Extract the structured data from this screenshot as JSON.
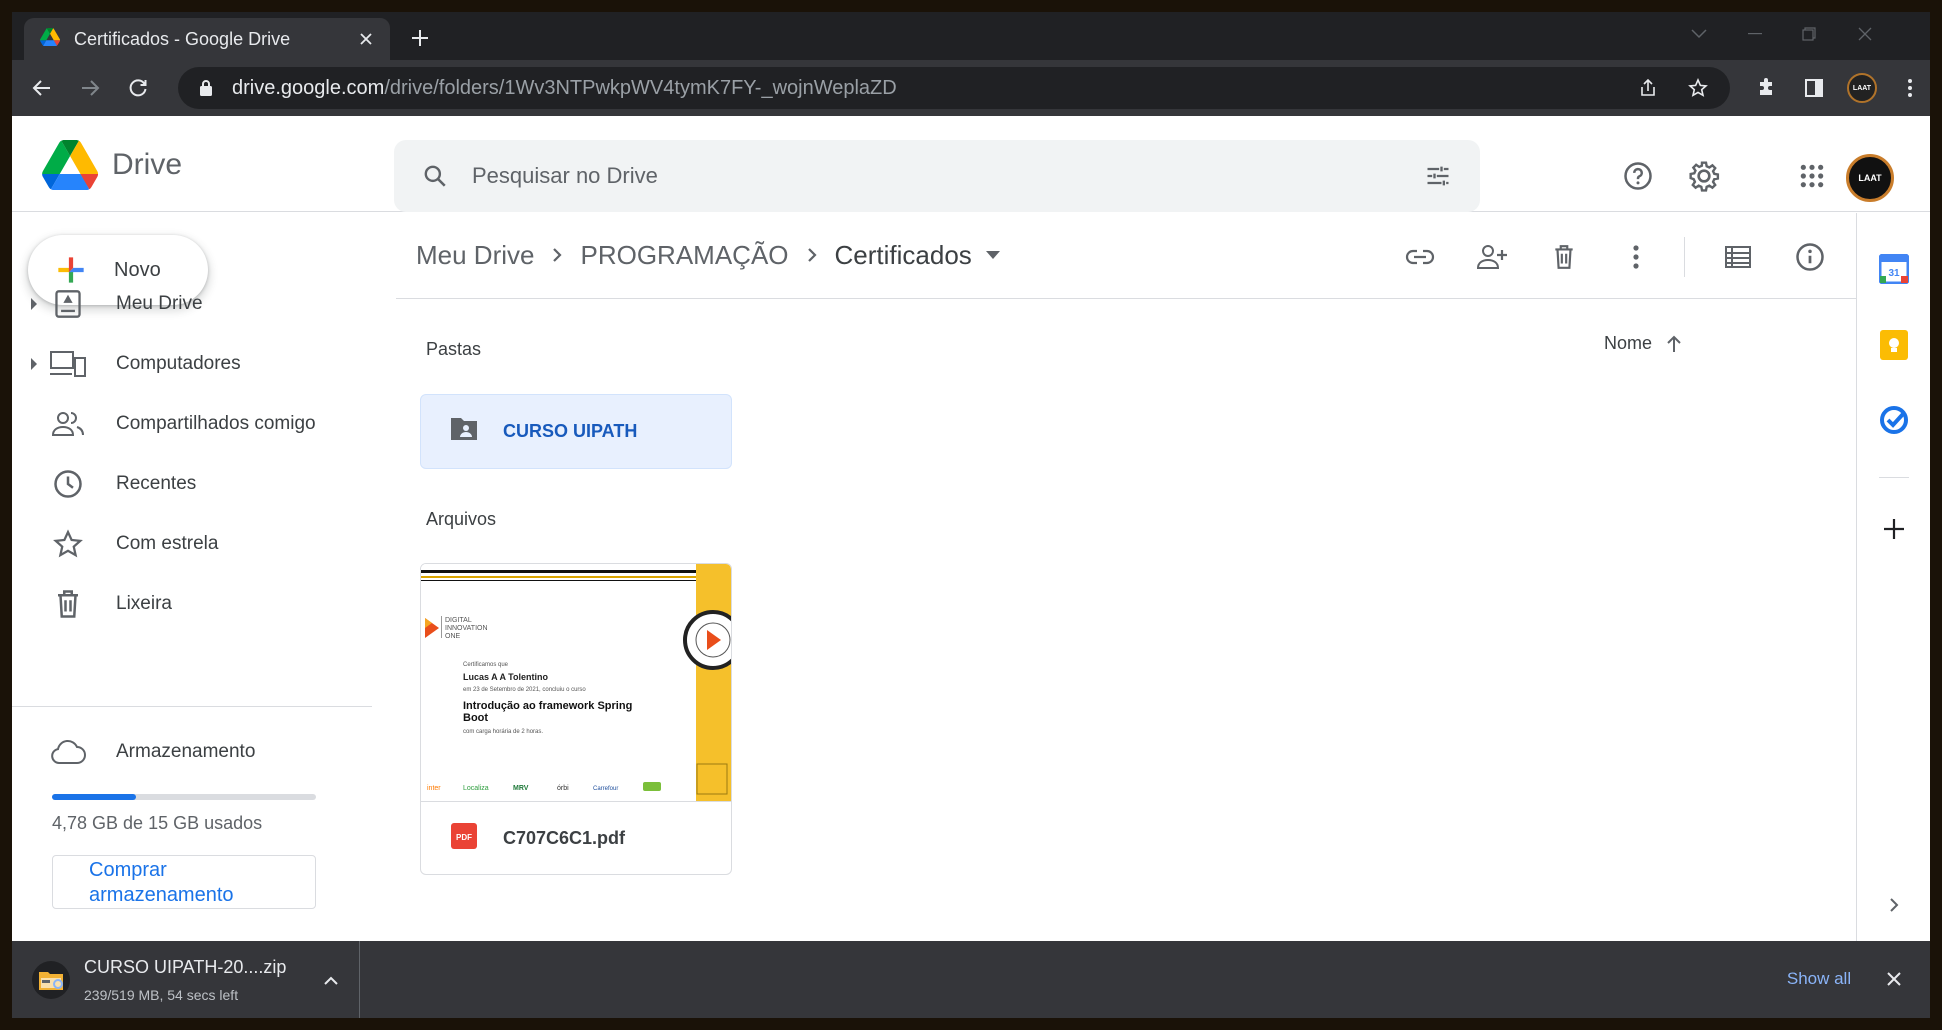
{
  "browser": {
    "tab_title": "Certificados - Google Drive",
    "url_host": "drive.google.com",
    "url_path": "/drive/folders/1Wv3NTPwkpWV4tymK7FY-_wojnWeplaZD",
    "profile_label": "LAAT"
  },
  "drive": {
    "app_name": "Drive",
    "search_placeholder": "Pesquisar no Drive",
    "account_label": "LAAT",
    "new_button": "Novo",
    "nav": [
      {
        "label": "Meu Drive"
      },
      {
        "label": "Computadores"
      },
      {
        "label": "Compartilhados comigo"
      },
      {
        "label": "Recentes"
      },
      {
        "label": "Com estrela"
      },
      {
        "label": "Lixeira"
      },
      {
        "label": "Armazenamento"
      }
    ],
    "storage": {
      "used_fraction": 0.32,
      "text": "4,78 GB de 15 GB usados",
      "buy_button": "Comprar armazenamento"
    },
    "breadcrumb": [
      "Meu Drive",
      "PROGRAMAÇÃO",
      "Certificados"
    ],
    "sections": {
      "folders": "Pastas",
      "files": "Arquivos"
    },
    "sort_label": "Nome",
    "folder": {
      "name": "CURSO UIPATH"
    },
    "file": {
      "name": "C707C6C1.pdf",
      "file_type_badge": "PDF",
      "thumb": {
        "brand_line1": "DIGITAL",
        "brand_line2": "INNOVATION",
        "brand_line3": "ONE",
        "intro": "Certificamos que",
        "person": "Lucas A A Tolentino",
        "date_line": "em 23 de Setembro de 2021, concluiu o curso",
        "course": "Introdução ao framework Spring Boot",
        "hours": "com carga horária de 2 horas.",
        "partners": [
          "inter",
          "Localiza",
          "MRV",
          "órbi",
          "Carrefour",
          ""
        ]
      }
    }
  },
  "download": {
    "file_name": "CURSO UIPATH-20....zip",
    "status": "239/519 MB, 54 secs left",
    "show_all": "Show all"
  },
  "colors": {
    "accent": "#1a73e8",
    "chrome_dark": "#202124",
    "chrome_toolbar": "#35363a",
    "folder_selected_bg": "#e8f0fe",
    "pdf_red": "#ea4335"
  }
}
